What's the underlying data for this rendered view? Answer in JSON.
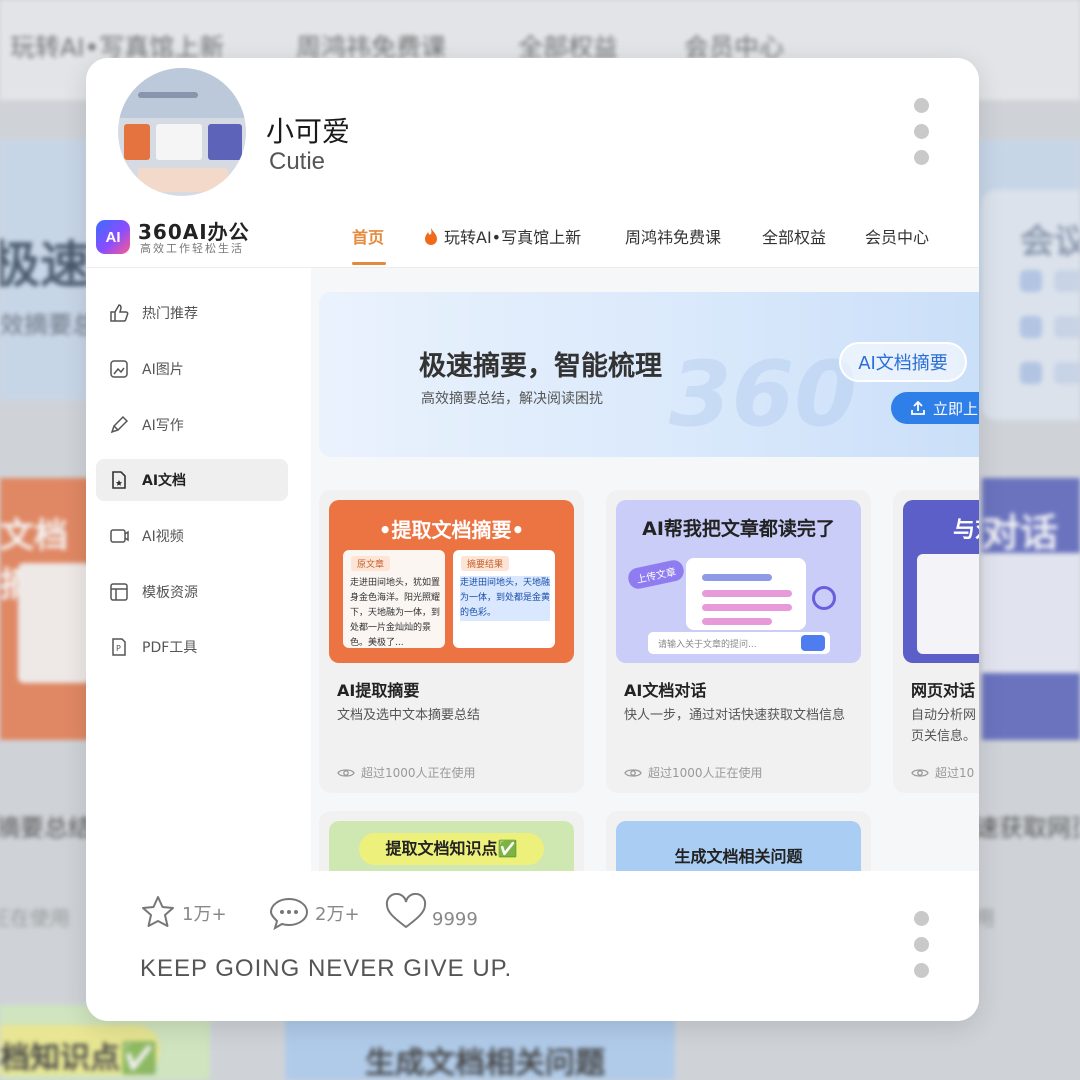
{
  "background": {
    "nav_items": [
      "玩转AI•写真馆上新",
      "周鸿祎免费课",
      "全部权益",
      "会员中心"
    ],
    "banner_title": "极速摘",
    "banner_sub": "效摘要总",
    "side_title": "会议",
    "left_card_title": "文档摘",
    "right_card_title": "对话",
    "left_text": "摘要总结",
    "left_text2": "正在使用",
    "right_text": "速获取网页",
    "right_text2": "用",
    "bottom_left": "档知识点✅",
    "bottom_mid": "生成文档相关问题"
  },
  "post": {
    "user_name": "小可爱",
    "user_sub": "Cutie"
  },
  "app": {
    "logo_text": "AI",
    "brand": "360AI办公",
    "slogan": "高效工作轻松生活",
    "nav": [
      {
        "label": "首页",
        "active": true
      },
      {
        "label": "玩转AI•写真馆上新",
        "active": false
      },
      {
        "label": "周鸿祎免费课",
        "active": false
      },
      {
        "label": "全部权益",
        "active": false
      },
      {
        "label": "会员中心",
        "active": false
      }
    ],
    "sidebar": [
      {
        "label": "热门推荐",
        "icon": "thumbs-up-icon"
      },
      {
        "label": "AI图片",
        "icon": "image-icon"
      },
      {
        "label": "AI写作",
        "icon": "pen-icon"
      },
      {
        "label": "AI文档",
        "icon": "document-star-icon",
        "active": true
      },
      {
        "label": "AI视频",
        "icon": "video-icon"
      },
      {
        "label": "模板资源",
        "icon": "template-icon"
      },
      {
        "label": "PDF工具",
        "icon": "pdf-icon"
      }
    ],
    "banner": {
      "title": "极速摘要，智能梳理",
      "subtitle": "高效摘要总结，解决阅读困扰",
      "pill": "AI文档摘要",
      "button": "立即上",
      "watermark": "360"
    },
    "cards": [
      {
        "thumb_title": "•提取文档摘要•",
        "tag_a": "原文章",
        "tag_b": "摘要结果",
        "text_a": "走进田间地头，犹如置身金色海洋。阳光照耀下，天地融为一体，到处都一片金灿灿的景色。美极了...",
        "text_b": "走进田间地头，天地融为一体，到处都是金黄的色彩。",
        "title": "AI提取摘要",
        "desc": "文档及选中文本摘要总结",
        "usage": "超过1000人正在使用"
      },
      {
        "thumb_title": "AI帮我把文章都读完了",
        "chip": "上传文章",
        "input": "请输入关于文章的提问...",
        "title": "AI文档对话",
        "desc": "快人一步，通过对话快速获取文档信息",
        "usage": "超过1000人正在使用"
      },
      {
        "thumb_title": "与对话",
        "title": "网页对话",
        "desc": "自动分析网页关信息。",
        "usage": "超过10"
      }
    ],
    "lower_cards": [
      "提取文档知识点✅",
      "生成文档相关问题"
    ]
  },
  "footer": {
    "stars": "1万+",
    "comments": "2万+",
    "likes": "9999",
    "motto": "KEEP GOING NEVER GIVE UP."
  },
  "colors": {
    "accent": "#e38a3c",
    "primary_blue": "#2f7fe8",
    "card_orange": "#ec7342",
    "card_lavender": "#c9cdf7",
    "card_indigo": "#5b5fc7"
  }
}
